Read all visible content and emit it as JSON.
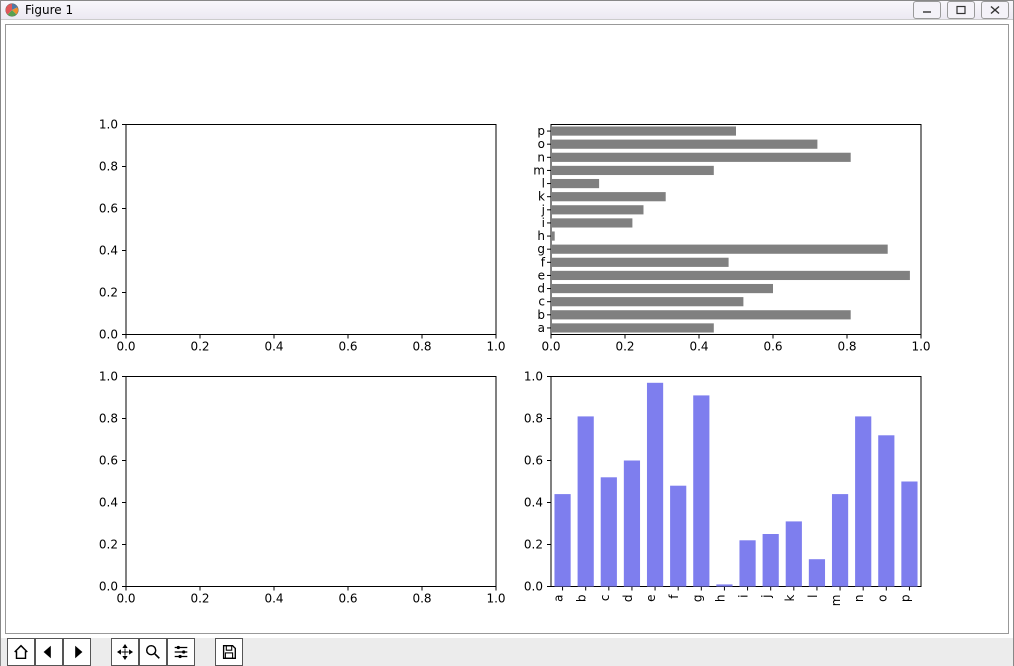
{
  "window": {
    "title": "Figure 1"
  },
  "toolbar": {
    "home": "Home",
    "back": "Back",
    "forward": "Forward",
    "pan": "Pan",
    "zoom": "Zoom",
    "configure": "Configure subplots",
    "save": "Save"
  },
  "chart_data": [
    {
      "id": "top-left",
      "type": "empty",
      "xlim": [
        0.0,
        1.0
      ],
      "ylim": [
        0.0,
        1.0
      ],
      "xticks": [
        0.0,
        0.2,
        0.4,
        0.6,
        0.8,
        1.0
      ],
      "yticks": [
        0.0,
        0.2,
        0.4,
        0.6,
        0.8,
        1.0
      ],
      "xtick_labels": [
        "0.0",
        "0.2",
        "0.4",
        "0.6",
        "0.8",
        "1.0"
      ],
      "ytick_labels": [
        "0.0",
        "0.2",
        "0.4",
        "0.6",
        "0.8",
        "1.0"
      ]
    },
    {
      "id": "top-right",
      "type": "barh",
      "categories": [
        "a",
        "b",
        "c",
        "d",
        "e",
        "f",
        "g",
        "h",
        "i",
        "j",
        "k",
        "l",
        "m",
        "n",
        "o",
        "p"
      ],
      "values": [
        0.44,
        0.81,
        0.52,
        0.6,
        0.97,
        0.48,
        0.91,
        0.01,
        0.22,
        0.25,
        0.31,
        0.13,
        0.44,
        0.81,
        0.72,
        0.5
      ],
      "xlim": [
        0.0,
        1.0
      ],
      "xticks": [
        0.0,
        0.2,
        0.4,
        0.6,
        0.8,
        1.0
      ],
      "xtick_labels": [
        "0.0",
        "0.2",
        "0.4",
        "0.6",
        "0.8",
        "1.0"
      ],
      "bar_color": "#808080"
    },
    {
      "id": "bottom-left",
      "type": "empty",
      "xlim": [
        0.0,
        1.0
      ],
      "ylim": [
        0.0,
        1.0
      ],
      "xticks": [
        0.0,
        0.2,
        0.4,
        0.6,
        0.8,
        1.0
      ],
      "yticks": [
        0.0,
        0.2,
        0.4,
        0.6,
        0.8,
        1.0
      ],
      "xtick_labels": [
        "0.0",
        "0.2",
        "0.4",
        "0.6",
        "0.8",
        "1.0"
      ],
      "ytick_labels": [
        "0.0",
        "0.2",
        "0.4",
        "0.6",
        "0.8",
        "1.0"
      ]
    },
    {
      "id": "bottom-right",
      "type": "bar",
      "categories": [
        "a",
        "b",
        "c",
        "d",
        "e",
        "f",
        "g",
        "h",
        "i",
        "j",
        "k",
        "l",
        "m",
        "n",
        "o",
        "p"
      ],
      "values": [
        0.44,
        0.81,
        0.52,
        0.6,
        0.97,
        0.48,
        0.91,
        0.01,
        0.22,
        0.25,
        0.31,
        0.13,
        0.44,
        0.81,
        0.72,
        0.5
      ],
      "ylim": [
        0.0,
        1.0
      ],
      "yticks": [
        0.0,
        0.2,
        0.4,
        0.6,
        0.8,
        1.0
      ],
      "ytick_labels": [
        "0.0",
        "0.2",
        "0.4",
        "0.6",
        "0.8",
        "1.0"
      ],
      "bar_color": "#7e7eee",
      "xtick_rotation": 90
    }
  ]
}
